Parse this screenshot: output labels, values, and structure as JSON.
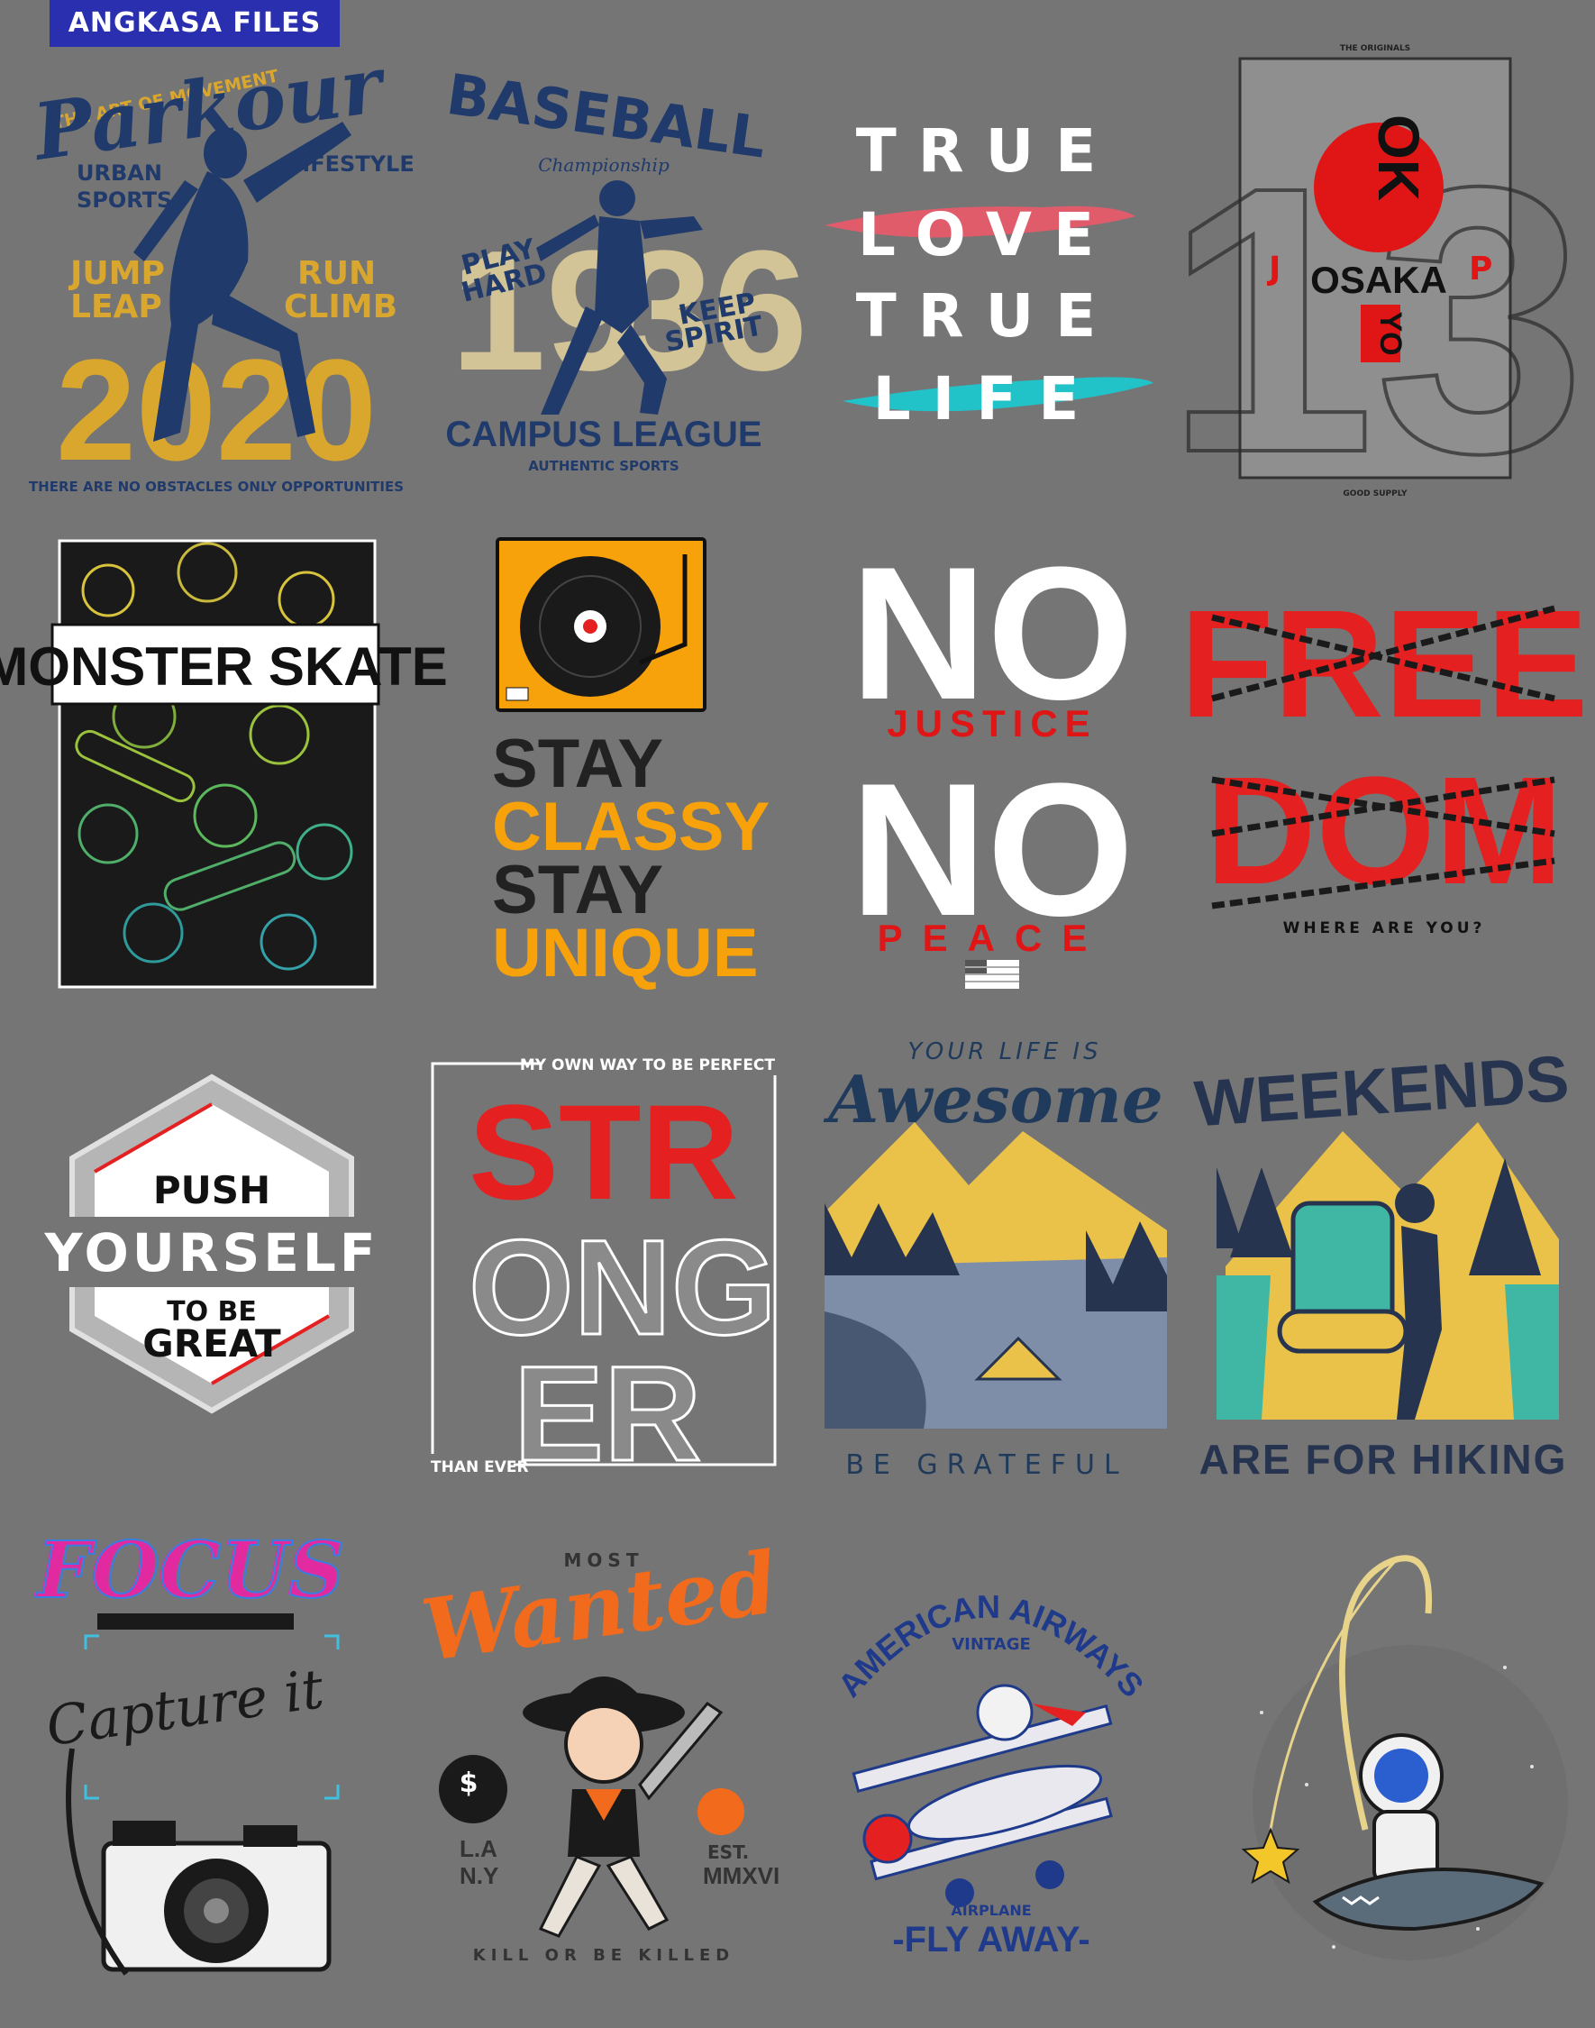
{
  "header": {
    "badge": "ANGKASA FILES"
  },
  "designs": {
    "parkour": {
      "top": "THE ART OF MOVEMENT",
      "title": "Parkour",
      "left1": "URBAN",
      "left2": "SPORTS",
      "right1": "LIFESTYLE",
      "l3": "JUMP",
      "l4": "LEAP",
      "r3": "RUN",
      "r4": "CLIMB",
      "year": "2020",
      "bottom": "THERE ARE NO OBSTACLES ONLY OPPORTUNITIES"
    },
    "baseball": {
      "title": "BASEBALL",
      "sub": "Championship",
      "num1": "19",
      "num2": "36",
      "play1": "PLAY",
      "play2": "HARD",
      "keep1": "KEEP",
      "keep2": "SPIRIT",
      "league": "CAMPUS LEAGUE",
      "auth": "AUTHENTIC SPORTS"
    },
    "truelove": {
      "w1": "TRUE",
      "w2": "LOVE",
      "w3": "TRUE",
      "w4": "LIFE"
    },
    "tokyo": {
      "top": "THE ORIGINALS",
      "ok": "OK",
      "osaka": "OSAKA",
      "yo": "YO",
      "j": "J",
      "p": "P",
      "bottom": "GOOD SUPPLY"
    },
    "monster": {
      "title": "MONSTER SKATE"
    },
    "classy": {
      "l1": "STAY",
      "l2": "CLASSY",
      "l3": "STAY",
      "l4": "UNIQUE"
    },
    "nojustice": {
      "no1": "NO",
      "justice": "JUSTICE",
      "no2": "NO",
      "peace": "PEACE"
    },
    "freedom": {
      "free": "FREE",
      "dom": "DOM",
      "sub": "WHERE ARE YOU?"
    },
    "push": {
      "l1": "PUSH",
      "l2": "YOURSELF",
      "l3": "TO BE",
      "l4": "GREAT"
    },
    "stronger": {
      "top": "MY OWN WAY TO BE PERFECT",
      "s1": "STR",
      "s2": "ONG",
      "s3": "ER",
      "bottom": "THAN EVER"
    },
    "awesome": {
      "top": "YOUR LIFE IS",
      "title": "Awesome",
      "bottom": "BE GRATEFUL"
    },
    "weekends": {
      "title": "WEEKENDS",
      "bottom": "ARE FOR HIKING"
    },
    "focus": {
      "title": "FOCUS",
      "script": "Capture it"
    },
    "wanted": {
      "most": "MOST",
      "title": "Wanted",
      "la": "L.A",
      "ny": "N.Y",
      "est": "EST.",
      "year": "MMXVI",
      "bottom": "KILL OR BE KILLED"
    },
    "airways": {
      "title": "AMERICAN AIRWAYS",
      "vintage": "VINTAGE",
      "plane": "AIRPLANE",
      "fly": "-FLY AWAY-"
    }
  },
  "colors": {
    "bg": "#757575",
    "badge": "#2a2fb0",
    "navy": "#1f3a6b",
    "gold": "#d9a72e",
    "red": "#e42020",
    "orange": "#f7a20b",
    "teal": "#3fb7a4"
  }
}
